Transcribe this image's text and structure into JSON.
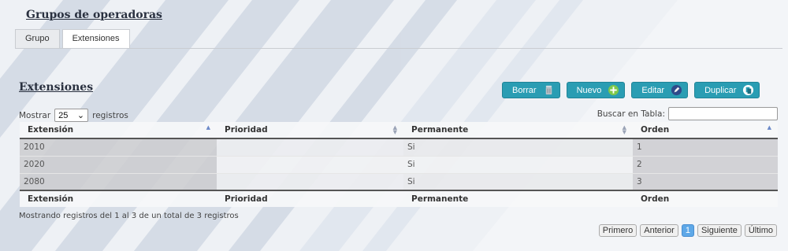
{
  "page": {
    "title": "Grupos de operadoras"
  },
  "tabs": [
    {
      "label": "Grupo",
      "active": false
    },
    {
      "label": "Extensiones",
      "active": true
    }
  ],
  "section": {
    "title": "Extensiones"
  },
  "actions": {
    "delete_label": "Borrar",
    "new_label": "Nuevo",
    "edit_label": "Editar",
    "duplicate_label": "Duplicar",
    "delete_icon": "trash-icon",
    "new_icon": "plus-icon",
    "edit_icon": "pencil-icon",
    "duplicate_icon": "copy-icon"
  },
  "length": {
    "prefix": "Mostrar",
    "value": "25",
    "suffix": "registros"
  },
  "search": {
    "label": "Buscar en Tabla:",
    "value": ""
  },
  "table": {
    "columns": [
      "Extensión",
      "Prioridad",
      "Permanente",
      "Orden"
    ],
    "rows": [
      [
        "2010",
        "",
        "Si",
        "1"
      ],
      [
        "2020",
        "",
        "Si",
        "2"
      ],
      [
        "2080",
        "",
        "Si",
        "3"
      ]
    ]
  },
  "info": "Mostrando registros del 1 al 3 de un total de 3 registros",
  "pager": {
    "first": "Primero",
    "prev": "Anterior",
    "current": "1",
    "next": "Siguiente",
    "last": "Último"
  },
  "colors": {
    "accent": "#2a9db3",
    "page_current": "#5ea8e8"
  }
}
